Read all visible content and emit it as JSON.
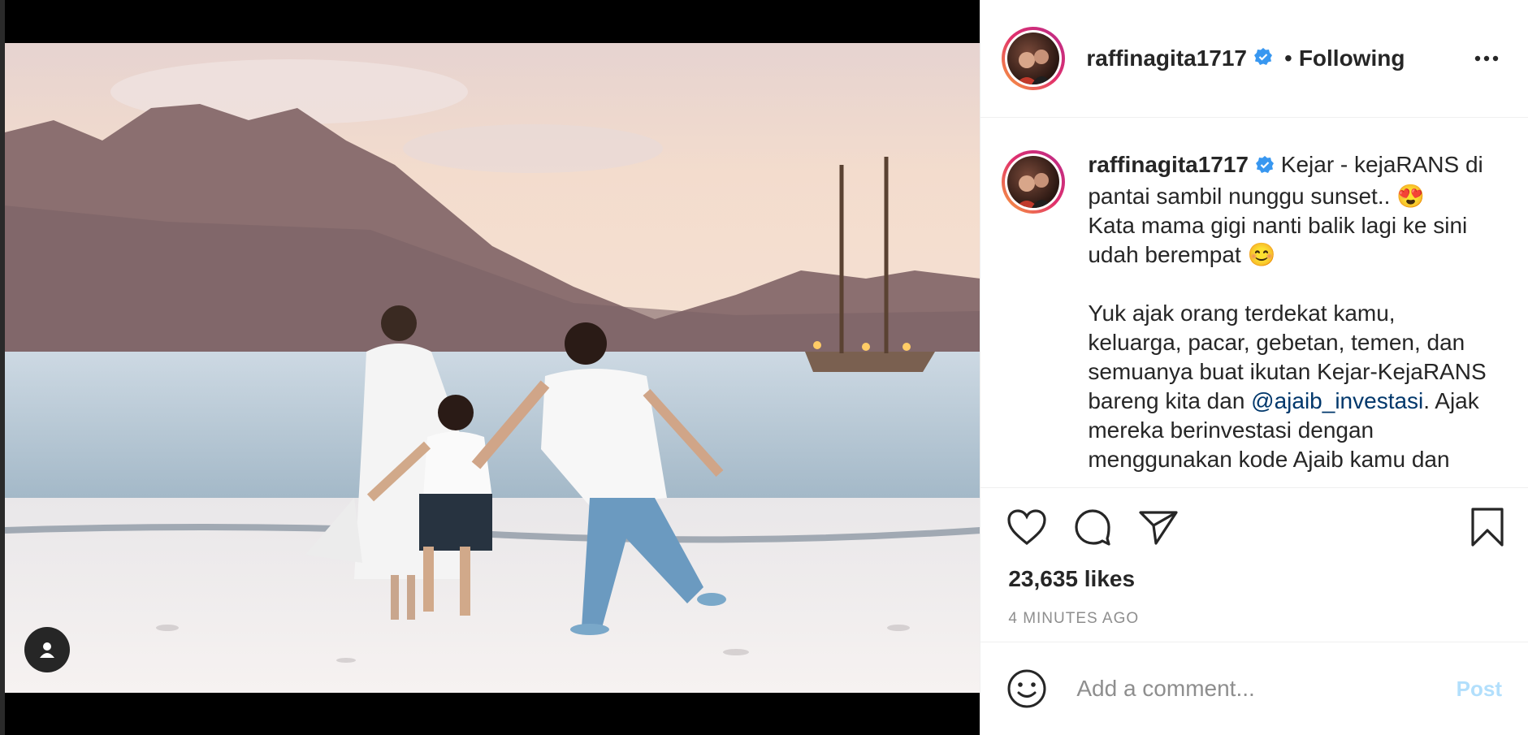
{
  "post": {
    "username": "raffinagita1717",
    "follow_sep": "•",
    "follow_label": "Following",
    "caption": {
      "username": "raffinagita1717",
      "line1": "Kejar - kejaRANS di pantai sambil nunggu sunset.. 😍",
      "line2": "Kata mama gigi nanti balik lagi ke sini udah berempat 😊",
      "para2_before": "Yuk ajak orang terdekat kamu, keluarga, pacar, gebetan, temen, dan semuanya buat ikutan Kejar-KejaRANS bareng kita dan ",
      "mention": "@ajaib_investasi",
      "para2_after": ". Ajak mereka berinvestasi dengan menggunakan kode Ajaib kamu dan"
    },
    "likes": "23,635 likes",
    "time_ago": "4 MINUTES AGO"
  },
  "comment": {
    "placeholder": "Add a comment...",
    "post_label": "Post"
  },
  "icons": {
    "like": "heart-icon",
    "comment": "comment-icon",
    "share": "paper-plane-icon",
    "save": "bookmark-icon",
    "more": "more-options-icon",
    "emoji": "smiley-icon",
    "tag": "user-tag-icon",
    "verified": "verified-badge-icon"
  },
  "colors": {
    "verified": "#3897f0",
    "mention": "#00376b",
    "post_disabled": "#b2dffc",
    "muted": "#8e8e8e"
  }
}
